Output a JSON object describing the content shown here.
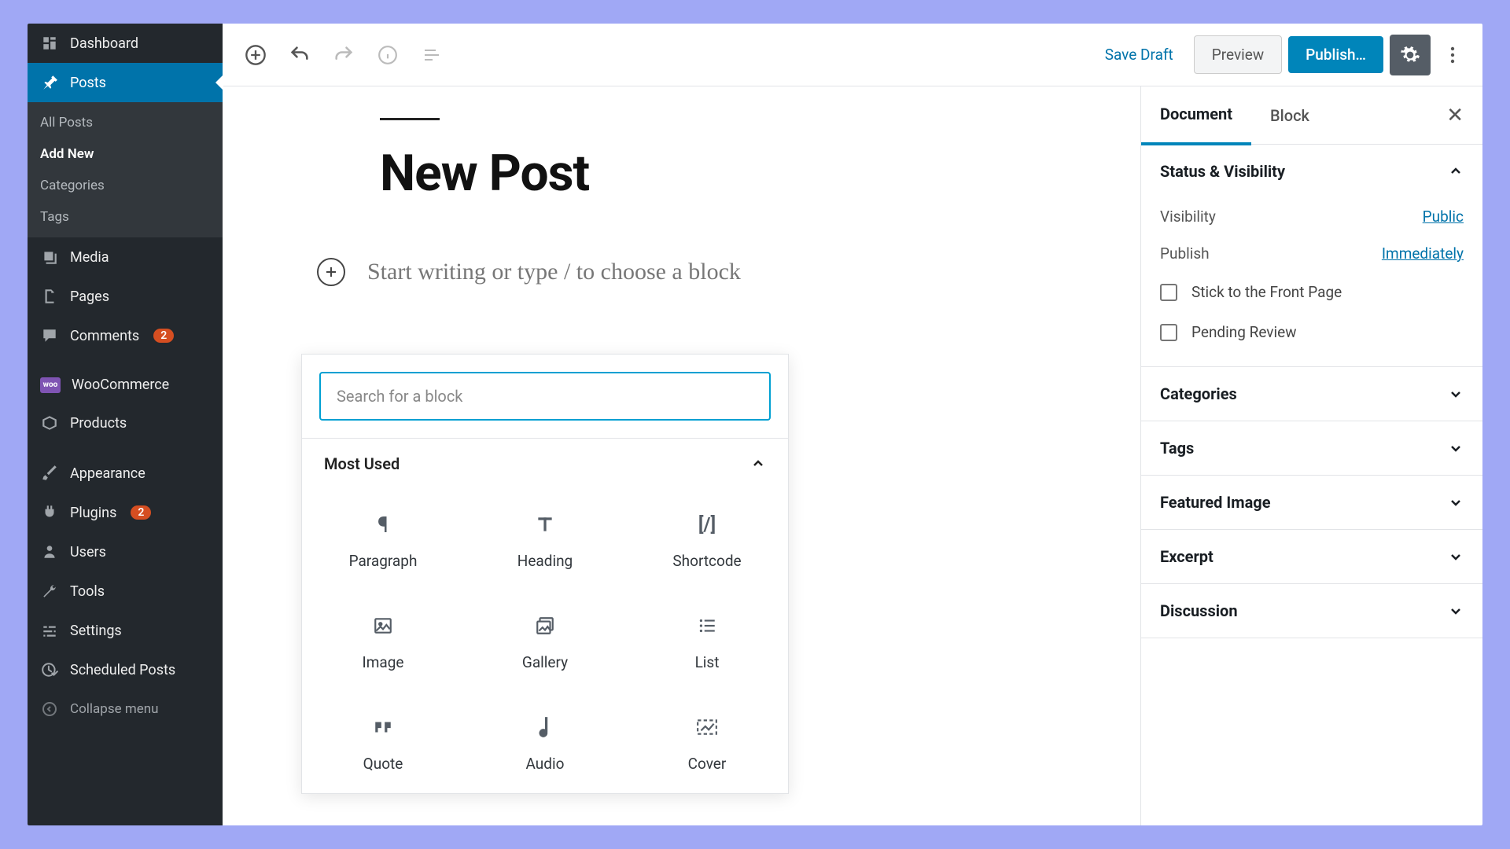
{
  "sidebar": {
    "dashboard": "Dashboard",
    "posts": "Posts",
    "posts_sub": {
      "all": "All Posts",
      "add": "Add New",
      "cats": "Categories",
      "tags": "Tags"
    },
    "media": "Media",
    "pages": "Pages",
    "comments": "Comments",
    "comments_count": "2",
    "woo": "WooCommerce",
    "products": "Products",
    "appearance": "Appearance",
    "plugins": "Plugins",
    "plugins_count": "2",
    "users": "Users",
    "tools": "Tools",
    "settings": "Settings",
    "scheduled": "Scheduled Posts",
    "collapse": "Collapse menu"
  },
  "topbar": {
    "save_draft": "Save Draft",
    "preview": "Preview",
    "publish": "Publish…"
  },
  "editor": {
    "title": "New Post",
    "body_placeholder": "Start writing or type / to choose a block",
    "search_placeholder": "Search for a block",
    "section_most_used": "Most Used",
    "blocks": {
      "paragraph": "Paragraph",
      "heading": "Heading",
      "shortcode": "Shortcode",
      "image": "Image",
      "gallery": "Gallery",
      "list": "List",
      "quote": "Quote",
      "audio": "Audio",
      "cover": "Cover"
    }
  },
  "panel": {
    "tab_document": "Document",
    "tab_block": "Block",
    "status_visibility": "Status & Visibility",
    "visibility": "Visibility",
    "visibility_value": "Public",
    "publish": "Publish",
    "publish_value": "Immediately",
    "stick_front": "Stick to the Front Page",
    "pending_review": "Pending Review",
    "categories": "Categories",
    "tags": "Tags",
    "featured_image": "Featured Image",
    "excerpt": "Excerpt",
    "discussion": "Discussion"
  }
}
